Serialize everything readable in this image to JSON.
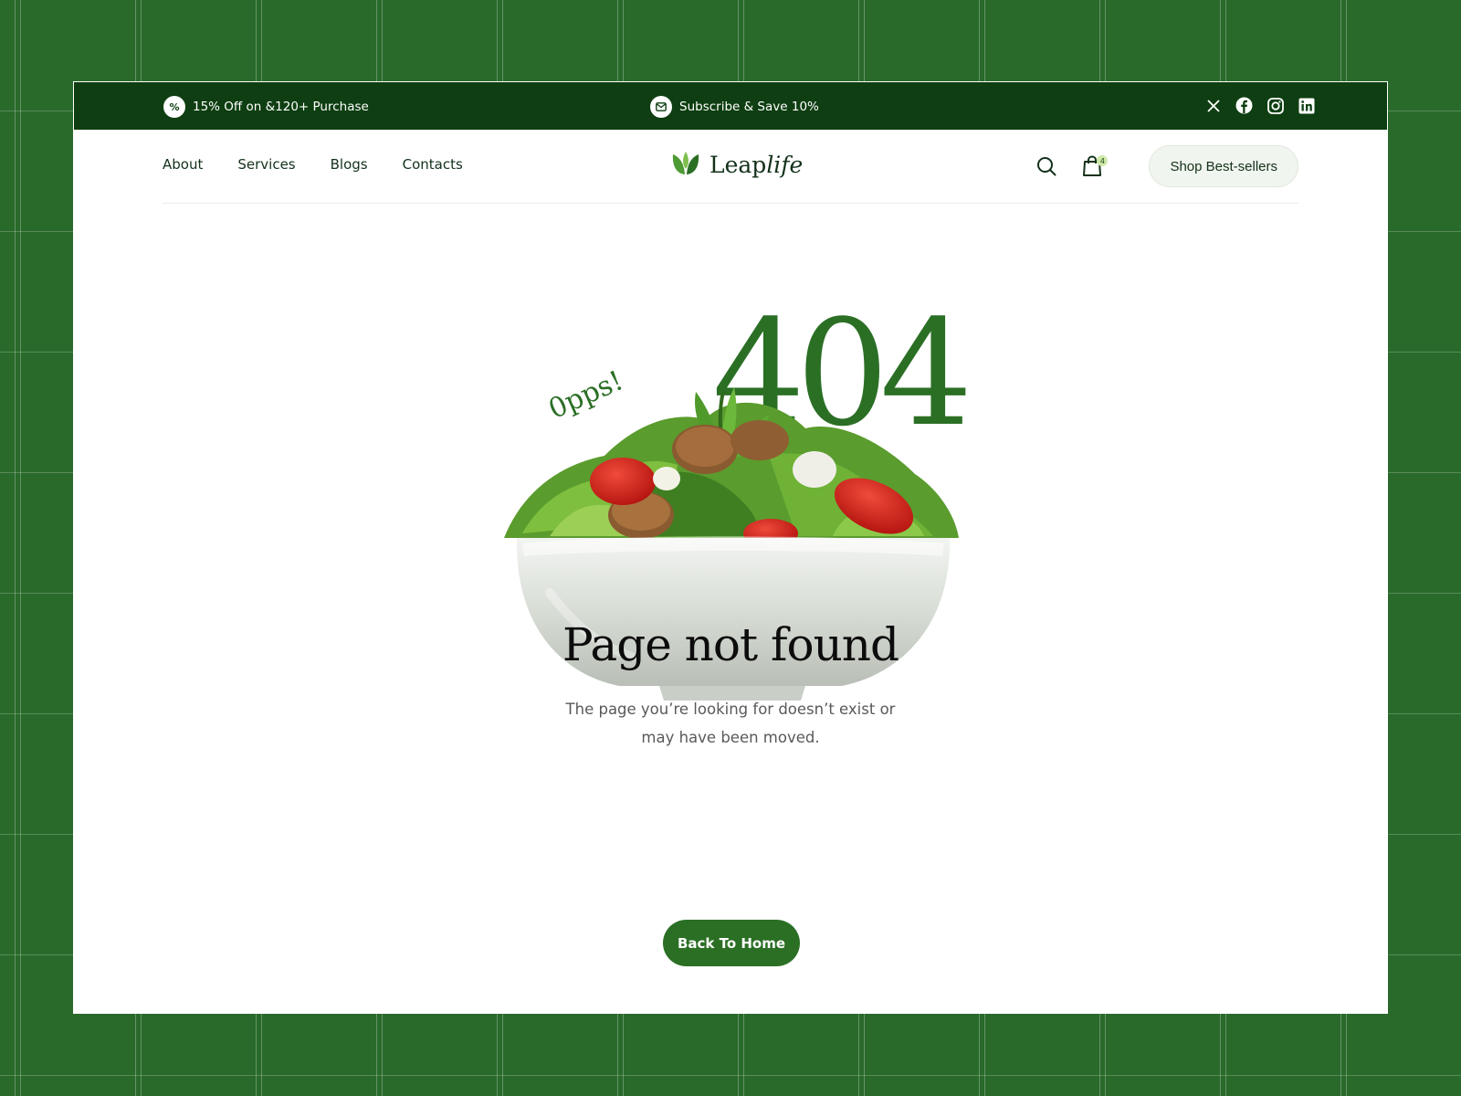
{
  "topbar": {
    "promo_icon": "percent-badge-icon",
    "promo_text": "15% Off on &120+ Purchase",
    "subscribe_icon": "mail-icon",
    "subscribe_text": "Subscribe & Save 10%",
    "socials": [
      "x-icon",
      "facebook-icon",
      "instagram-icon",
      "linkedin-icon"
    ]
  },
  "nav": {
    "links": [
      "About",
      "Services",
      "Blogs",
      "Contacts"
    ],
    "logo": {
      "prefix": "Leap",
      "suffix": "life"
    },
    "cart_count": "4",
    "cta": "Shop Best-sellers"
  },
  "hero": {
    "code": "404",
    "exclaim": "0pps!",
    "title": "Page not found",
    "subtitle": "The page you’re looking for doesn’t exist or may have been moved.",
    "button": "Back To Home"
  },
  "colors": {
    "background": "#296a2a",
    "topbar": "#0e3e11",
    "accent": "#2b6f25",
    "text_dark": "#13311a"
  }
}
